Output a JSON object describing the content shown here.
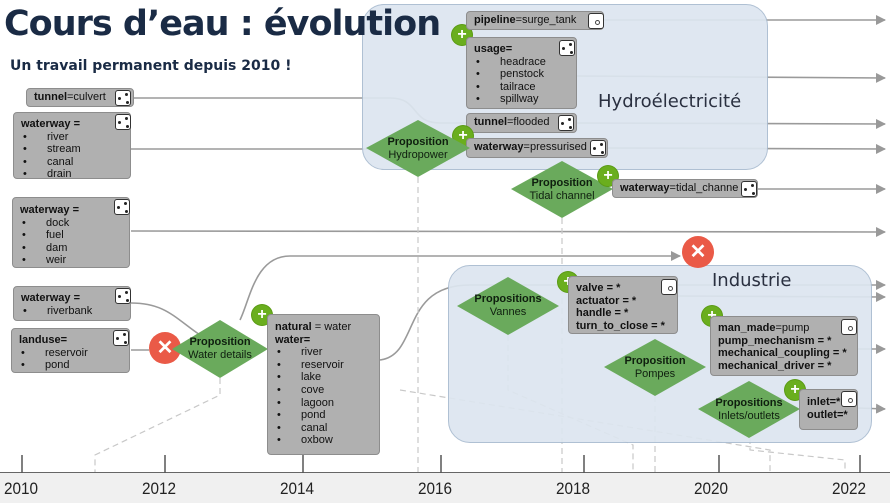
{
  "title": "Cours d’eau : évolution",
  "subtitle": "Un travail permanent depuis 2010 !",
  "groups": {
    "hydro": "Hydroélectricité",
    "industrie": "Industrie"
  },
  "tags": {
    "tunnel_culvert": {
      "key": "tunnel",
      "value": "=culvert"
    },
    "waterway1": {
      "key": "waterway =",
      "items": [
        "river",
        "stream",
        "canal",
        "drain"
      ]
    },
    "waterway2": {
      "key": "waterway =",
      "items": [
        "dock",
        "fuel",
        "dam",
        "weir"
      ]
    },
    "waterway_riverbank": {
      "key": "waterway =",
      "items": [
        "riverbank"
      ]
    },
    "landuse": {
      "key": "landuse=",
      "items": [
        "reservoir",
        "pond"
      ]
    },
    "natural_water": {
      "key": "natural",
      "value": " = water",
      "key2": "water=",
      "items": [
        "river",
        "reservoir",
        "lake",
        "cove",
        "lagoon",
        "pond",
        "canal",
        "oxbow"
      ]
    },
    "pipeline": {
      "key": "pipeline",
      "value": "=surge_tank"
    },
    "usage": {
      "key": "usage=",
      "items": [
        "headrace",
        "penstock",
        "tailrace",
        "spillway"
      ]
    },
    "tunnel_flooded": {
      "key": "tunnel",
      "value": "=flooded"
    },
    "waterway_pressurised": {
      "key": "waterway",
      "value": "=pressurised"
    },
    "waterway_tidal": {
      "key": "waterway",
      "value": "=tidal_channe"
    },
    "valve": {
      "lines": [
        "valve = *",
        "actuator = *",
        "handle = *",
        "turn_to_close = *"
      ]
    },
    "pump": {
      "key": "man_made",
      "value": "=pump",
      "lines": [
        "pump_mechanism = *",
        "mechanical_coupling = *",
        "mechanical_driver = *"
      ]
    },
    "inlet": {
      "lines": [
        "inlet=*",
        "outlet=*"
      ]
    }
  },
  "propositions": {
    "water_details": {
      "title": "Proposition",
      "subtitle": "Water details"
    },
    "hydropower": {
      "title": "Proposition",
      "subtitle": "Hydropower"
    },
    "tidal": {
      "title": "Proposition",
      "subtitle": "Tidal channel"
    },
    "vannes": {
      "title": "Propositions",
      "subtitle": "Vannes"
    },
    "pompes": {
      "title": "Proposition",
      "subtitle": "Pompes"
    },
    "inlets": {
      "title": "Propositions",
      "subtitle": "Inlets/outlets"
    }
  },
  "icons": {
    "plus": "+",
    "cross": "✕"
  },
  "colors": {
    "title": "#1a2b45",
    "proposition": "#6aaa5c",
    "accepted": "#6aae1e",
    "rejected": "#ea5a47",
    "tag": "#b0b0b0",
    "group": "#dde6f0"
  },
  "timeline": {
    "years": [
      "2010",
      "2012",
      "2014",
      "2016",
      "2018",
      "2020",
      "2022"
    ]
  }
}
